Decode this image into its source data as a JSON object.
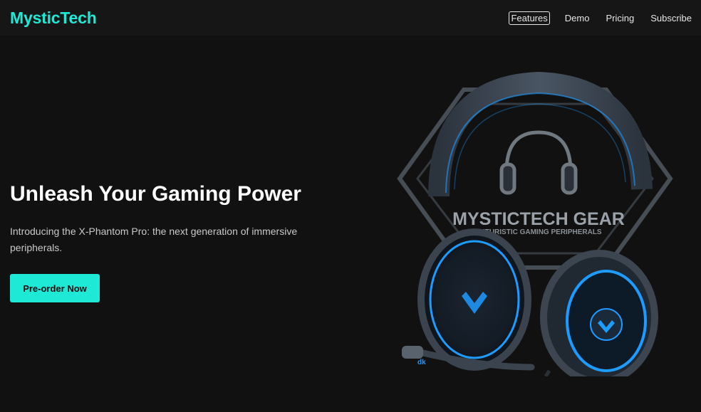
{
  "nav": {
    "brand": "MysticTech",
    "links": [
      "Features",
      "Demo",
      "Pricing",
      "Subscribe"
    ]
  },
  "hero": {
    "title": "Unleash Your Gaming Power",
    "subtitle": "Introducing the X-Phantom Pro: the next generation of immersive peripherals.",
    "cta_label": "Pre-order Now"
  },
  "product_image": {
    "logo_title": "MYSTICTECH GEAR",
    "logo_tagline": "FUTURISTIC GAMING PERIPHERALS",
    "mic_label": "dk"
  },
  "colors": {
    "accent": "#1de9d6",
    "background": "#111111",
    "navbar": "#161616",
    "glow_blue": "#1e9bff"
  }
}
